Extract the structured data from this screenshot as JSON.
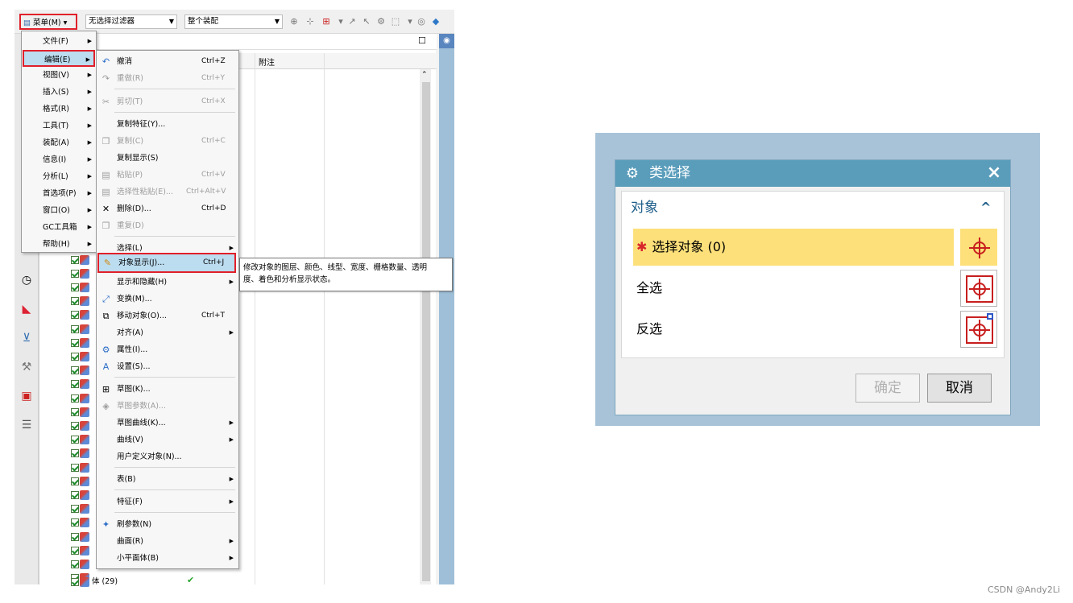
{
  "toolbar": {
    "menu_label": "菜单(M) ▾",
    "filter_value": "无选择过滤器",
    "scope_value": "整个装配"
  },
  "main_menu": [
    {
      "label": "文件(F)"
    },
    {
      "label": "编辑(E)",
      "active": true
    },
    {
      "label": "视图(V)"
    },
    {
      "label": "插入(S)"
    },
    {
      "label": "格式(R)"
    },
    {
      "label": "工具(T)"
    },
    {
      "label": "装配(A)"
    },
    {
      "label": "信息(I)"
    },
    {
      "label": "分析(L)"
    },
    {
      "label": "首选项(P)"
    },
    {
      "label": "窗口(O)"
    },
    {
      "label": "GC工具箱"
    },
    {
      "label": "帮助(H)"
    }
  ],
  "edit_menu": {
    "undo": {
      "label": "撤消",
      "shortcut": "Ctrl+Z"
    },
    "redo": {
      "label": "重做(R)",
      "shortcut": "Ctrl+Y"
    },
    "cut": {
      "label": "剪切(T)",
      "shortcut": "Ctrl+X"
    },
    "copy_feature": {
      "label": "复制特征(Y)..."
    },
    "copy": {
      "label": "复制(C)",
      "shortcut": "Ctrl+C"
    },
    "copy_display": {
      "label": "复制显示(S)"
    },
    "paste": {
      "label": "粘贴(P)",
      "shortcut": "Ctrl+V"
    },
    "paste_special": {
      "label": "选择性粘贴(E)...",
      "shortcut": "Ctrl+Alt+V"
    },
    "delete": {
      "label": "删除(D)...",
      "shortcut": "Ctrl+D"
    },
    "repeat": {
      "label": "重复(D)"
    },
    "select": {
      "label": "选择(L)"
    },
    "object_display": {
      "label": "对象显示(J)...",
      "shortcut": "Ctrl+J"
    },
    "show_hide": {
      "label": "显示和隐藏(H)"
    },
    "transform": {
      "label": "变换(M)..."
    },
    "move_object": {
      "label": "移动对象(O)...",
      "shortcut": "Ctrl+T"
    },
    "align": {
      "label": "对齐(A)"
    },
    "properties": {
      "label": "属性(I)..."
    },
    "settings": {
      "label": "设置(S)..."
    },
    "sketch": {
      "label": "草图(K)..."
    },
    "sketch_params": {
      "label": "草图参数(A)..."
    },
    "sketch_curve": {
      "label": "草图曲线(K)..."
    },
    "curve": {
      "label": "曲线(V)"
    },
    "udo": {
      "label": "用户定义对象(N)..."
    },
    "table": {
      "label": "表(B)"
    },
    "feature": {
      "label": "特征(F)"
    },
    "brush_params": {
      "label": "刷参数(N)"
    },
    "surface": {
      "label": "曲面(R)"
    },
    "facet_body": {
      "label": "小平面体(B)"
    }
  },
  "tooltip": {
    "line1": "修改对象的图层、颜色、线型、宽度、栅格数量、透明",
    "line2": "度、着色和分析显示状态。"
  },
  "navigator": {
    "column_note": "附注",
    "last_row_label": "体 (29)"
  },
  "dialog": {
    "title": "类选择",
    "close_icon": "×",
    "group_title": "对象",
    "collapse_icon": "^",
    "select_label": "选择对象 (0)",
    "select_all": "全选",
    "invert": "反选",
    "ok": "确定",
    "cancel": "取消",
    "colors": {
      "title_bar": "#5a9dbb",
      "highlight": "#fde07a",
      "accent_red": "#c81e1e"
    }
  },
  "watermark": "CSDN @Andy2Li"
}
